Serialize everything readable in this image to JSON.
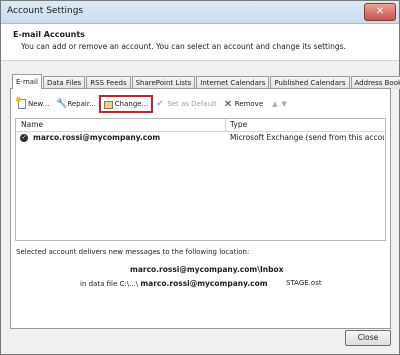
{
  "window": {
    "title": "Account Settings",
    "close_glyph": "✕"
  },
  "header": {
    "title": "E-mail Accounts",
    "description": "You can add or remove an account. You can select an account and change its settings."
  },
  "tabs": [
    {
      "label": "E-mail",
      "active": true
    },
    {
      "label": "Data Files"
    },
    {
      "label": "RSS Feeds"
    },
    {
      "label": "SharePoint Lists"
    },
    {
      "label": "Internet Calendars"
    },
    {
      "label": "Published Calendars"
    },
    {
      "label": "Address Books"
    }
  ],
  "toolbar": {
    "new_label": "New...",
    "repair_label": "Repair...",
    "change_label": "Change...",
    "set_default_label": "Set as Default",
    "remove_label": "Remove",
    "up_arrow": "▲",
    "down_arrow": "▼",
    "remove_icon_glyph": "✕",
    "repair_icon_glyph": "🔧",
    "default_icon_glyph": "✔",
    "highlight_color": "#c0262e"
  },
  "accounts_list": {
    "columns": [
      "Name",
      "Type"
    ],
    "rows": [
      {
        "name": "marco.rossi@mycompany.com",
        "type": "Microsoft Exchange (send from this account by defa...",
        "is_default": true,
        "check_glyph": "✓"
      }
    ]
  },
  "delivery": {
    "text": "Selected account delivers new messages to the following location:",
    "inbox_path": "marco.rossi@mycompany.com\\Inbox",
    "data_file_prefix": "in data file C:\\...\\",
    "data_file_account": "marco.rossi@mycompany.com",
    "data_file_suffix": "STAGE.ost"
  },
  "footer": {
    "close_label": "Close"
  }
}
